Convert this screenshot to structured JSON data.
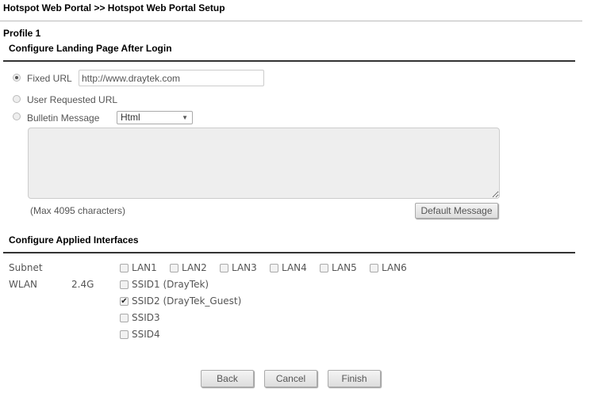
{
  "header": {
    "title": "Hotspot Web Portal >> Hotspot Web Portal Setup"
  },
  "profile": "Profile 1",
  "landing": {
    "heading": "Configure Landing Page After Login",
    "fixed_url_label": "Fixed URL",
    "fixed_url_value": "http://www.draytek.com",
    "fixed_url_selected": true,
    "user_requested_label": "User Requested URL",
    "bulletin_label": "Bulletin Message",
    "bulletin_format": "Html",
    "bulletin_text": "",
    "max_chars": "(Max 4095 characters)",
    "default_message_button": "Default Message"
  },
  "interfaces": {
    "heading": "Configure Applied Interfaces",
    "subnet_label": "Subnet",
    "lans": [
      {
        "label": "LAN1",
        "checked": false
      },
      {
        "label": "LAN2",
        "checked": false
      },
      {
        "label": "LAN3",
        "checked": false
      },
      {
        "label": "LAN4",
        "checked": false
      },
      {
        "label": "LAN5",
        "checked": false
      },
      {
        "label": "LAN6",
        "checked": false
      }
    ],
    "wlan_label": "WLAN",
    "band": "2.4G",
    "ssids": [
      {
        "label": "SSID1 (DrayTek)",
        "checked": false
      },
      {
        "label": "SSID2 (DrayTek_Guest)",
        "checked": true
      },
      {
        "label": "SSID3",
        "checked": false
      },
      {
        "label": "SSID4",
        "checked": false
      }
    ]
  },
  "buttons": {
    "back": "Back",
    "cancel": "Cancel",
    "finish": "Finish"
  }
}
